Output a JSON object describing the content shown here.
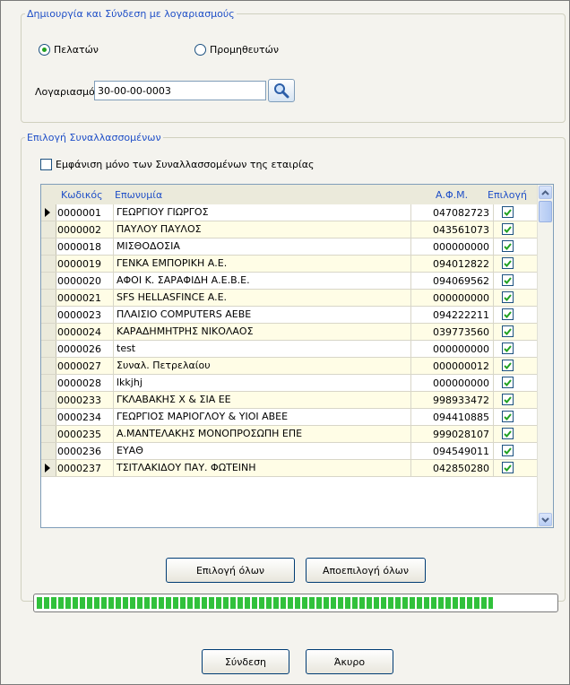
{
  "group_accounts": {
    "legend": "Δημιουργία και Σύνδεση με λογαριασμούς",
    "radio_customers": "Πελατών",
    "radio_suppliers": "Προμηθευτών",
    "selected_radio": "customers",
    "account_label": "Λογαριασμός",
    "account_value": "30-00-00-0003"
  },
  "group_partners": {
    "legend": "Επιλογή Συναλλασσομένων",
    "only_company_label": "Εμφάνιση μόνο των Συναλλασσομένων της εταιρίας",
    "only_company_checked": false
  },
  "grid": {
    "headers": {
      "code": "Κωδικός",
      "name": "Επωνυμία",
      "afm": "Α.Φ.Μ.",
      "select": "Επιλογή"
    },
    "rows": [
      {
        "code": "0000001",
        "name": "ΓΕΩΡΓΙΟΥ ΓΙΩΡΓΟΣ",
        "afm": "047082723",
        "selected": true,
        "current": true
      },
      {
        "code": "0000002",
        "name": "ΠΑΥΛΟΥ ΠΑΥΛΟΣ",
        "afm": "043561073",
        "selected": true,
        "current": false
      },
      {
        "code": "0000018",
        "name": "ΜΙΣΘΟΔΟΣΙΑ",
        "afm": "000000000",
        "selected": true,
        "current": false
      },
      {
        "code": "0000019",
        "name": "ΓΕΝΚΑ ΕΜΠΟΡΙΚΗ Α.Ε.",
        "afm": "094012822",
        "selected": true,
        "current": false
      },
      {
        "code": "0000020",
        "name": "ΑΦΟΙ Κ. ΣΑΡΑΦΙΔΗ Α.Ε.Β.Ε.",
        "afm": "094069562",
        "selected": true,
        "current": false
      },
      {
        "code": "0000021",
        "name": "SFS HELLASFINCE A.E.",
        "afm": "000000000",
        "selected": true,
        "current": false
      },
      {
        "code": "0000023",
        "name": "ΠΛΑΙΣΙΟ COMPUTERS ΑΕΒΕ",
        "afm": "094222211",
        "selected": true,
        "current": false
      },
      {
        "code": "0000024",
        "name": "ΚΑΡΑΔΗΜΗΤΡΗΣ ΝΙΚΟΛΑΟΣ",
        "afm": "039773560",
        "selected": true,
        "current": false
      },
      {
        "code": "0000026",
        "name": "test",
        "afm": "000000000",
        "selected": true,
        "current": false
      },
      {
        "code": "0000027",
        "name": "Συναλ. Πετρελαίου",
        "afm": "000000012",
        "selected": true,
        "current": false
      },
      {
        "code": "0000028",
        "name": "lkkjhj",
        "afm": "000000000",
        "selected": true,
        "current": false
      },
      {
        "code": "0000233",
        "name": "ΓΚΛΑΒΑΚΗΣ Χ & ΣΙΑ ΕΕ",
        "afm": "998933472",
        "selected": true,
        "current": false
      },
      {
        "code": "0000234",
        "name": "ΓΕΩΡΓΙΟΣ ΜΑΡΙΟΓΛΟΥ & ΥΙΟΙ ΑΒΕΕ",
        "afm": "094410885",
        "selected": true,
        "current": false
      },
      {
        "code": "0000235",
        "name": "Α.ΜΑΝΤΕΛΑΚΗΣ  ΜΟΝΟΠΡΟΣΩΠΗ ΕΠΕ",
        "afm": "999028107",
        "selected": true,
        "current": false
      },
      {
        "code": "0000236",
        "name": "ΕΥΑΘ",
        "afm": "094549011",
        "selected": true,
        "current": false
      },
      {
        "code": "0000237",
        "name": "ΤΣΙΤΛΑΚΙΔΟΥ ΠΑΥ. ΦΩΤΕΙΝΗ",
        "afm": "042850280",
        "selected": true,
        "current": true
      }
    ]
  },
  "buttons": {
    "select_all": "Επιλογή όλων",
    "deselect_all": "Αποεπιλογή όλων",
    "connect": "Σύνδεση",
    "cancel": "Άκυρο"
  },
  "progress": {
    "fraction": 0.88
  },
  "colors": {
    "legend": "#1f4fc7",
    "progress": "#31c13b",
    "check": "#21a121"
  }
}
